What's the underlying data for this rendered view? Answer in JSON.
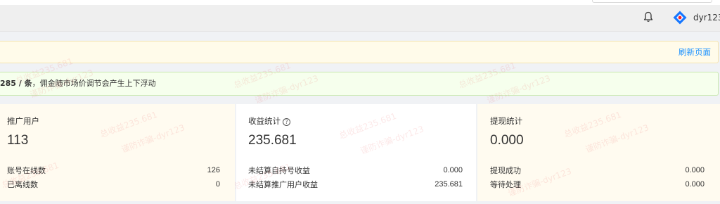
{
  "header": {
    "username": "dyr123",
    "icons": {
      "bell": "bell-icon",
      "logo": "logo-icon"
    }
  },
  "notice": {
    "refresh_label": "刷新页面"
  },
  "info": {
    "count_text": "285 / 条",
    "separator": "，",
    "message": "佣金随市场价调节会产生上下浮动"
  },
  "cards": {
    "promotion": {
      "title": "推广用户",
      "value": "113",
      "rows": [
        {
          "label": "账号在线数",
          "value": "126"
        },
        {
          "label": "已离线数",
          "value": "0"
        }
      ]
    },
    "income": {
      "title": "收益统计",
      "help_icon": "question-circle-icon",
      "value": "235.681",
      "rows": [
        {
          "label": "未结算自持号收益",
          "value": "0.000"
        },
        {
          "label": "未结算推广用户收益",
          "value": "235.681"
        }
      ]
    },
    "withdraw": {
      "title": "提现统计",
      "value": "0.000",
      "rows": [
        {
          "label": "提现成功",
          "value": "0.000"
        },
        {
          "label": "等待处理",
          "value": "0.000"
        }
      ]
    }
  },
  "watermark": {
    "total": "总收益235.681",
    "anti_fraud": "谨防诈骗-dyr123"
  },
  "colors": {
    "link": "#1890ff",
    "notice_bg": "#fffbea",
    "info_bg": "#f6ffed",
    "card_bg": "#fffbf0",
    "watermark": "#e45050"
  }
}
